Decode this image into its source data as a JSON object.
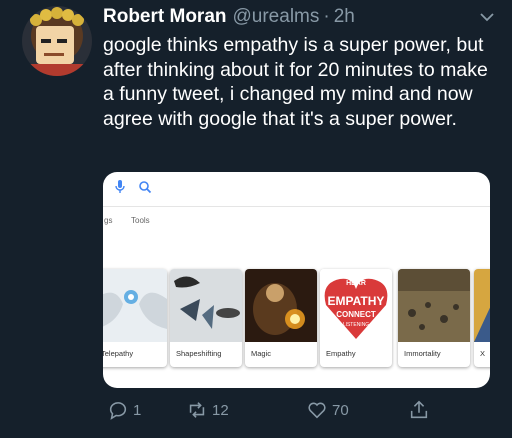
{
  "tweet": {
    "author_name": "Robert Moran",
    "handle": "@urealms",
    "separator": "·",
    "time": "2h",
    "text": "google thinks empathy is a super power, but after thinking about it for 20 minutes to make a funny tweet, i changed my mind and now agree with google that it's a super power."
  },
  "card": {
    "tools_label_left": "gs",
    "tools_label": "Tools",
    "tiles": [
      {
        "caption": "Telepathy"
      },
      {
        "caption": "Shapeshifting"
      },
      {
        "caption": "Magic"
      },
      {
        "caption": "Empathy"
      },
      {
        "caption": "Immortality"
      },
      {
        "caption": "X"
      }
    ],
    "empathy_words": {
      "top": "HEAR",
      "mid": "EMPATHY",
      "connect": "CONNECT",
      "bottom": "LISTENING"
    }
  },
  "actions": {
    "replies": "1",
    "retweets": "12",
    "likes": "70"
  },
  "colors": {
    "background": "#15202b",
    "secondary_text": "#8899a6",
    "google_blue": "#4285f4"
  },
  "icons": [
    "reply-icon",
    "retweet-icon",
    "like-icon",
    "share-icon",
    "chevron-down-icon",
    "mic-icon",
    "search-icon"
  ]
}
